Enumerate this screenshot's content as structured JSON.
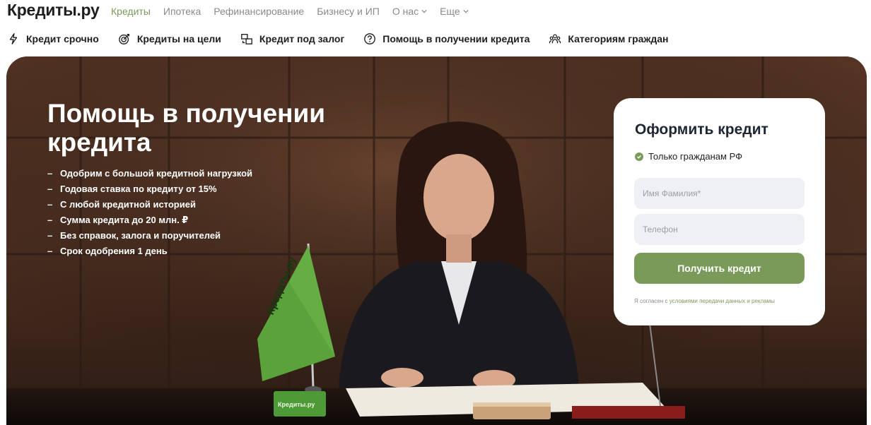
{
  "logo": "Кредиты.ру",
  "menu": [
    {
      "label": "Кредиты",
      "active": true
    },
    {
      "label": "Ипотека"
    },
    {
      "label": "Рефинансирование"
    },
    {
      "label": "Бизнесу и ИП"
    },
    {
      "label": "О нас",
      "dropdown": true
    },
    {
      "label": "Еще",
      "dropdown": true
    }
  ],
  "subnav": [
    {
      "label": "Кредит срочно",
      "icon": "lightning-icon"
    },
    {
      "label": "Кредиты на цели",
      "icon": "target-icon"
    },
    {
      "label": "Кредит под залог",
      "icon": "collateral-icon"
    },
    {
      "label": "Помощь в получении кредита",
      "icon": "question-icon"
    },
    {
      "label": "Категориям граждан",
      "icon": "people-icon"
    }
  ],
  "hero": {
    "title": "Помощь в получении кредита",
    "features": [
      "Одобрим с большой кредитной нагрузкой",
      "Годовая ставка по кредиту от 15%",
      "С любой кредитной историей",
      "Сумма кредита до 20 млн. ₽",
      "Без справок, залога и поручителей",
      "Срок одобрения 1 день"
    ],
    "dash": "–",
    "flag_text": "Кредиты.ру",
    "desk_sign": "Кредиты.ру"
  },
  "form": {
    "title": "Оформить кредит",
    "badge": "Только гражданам РФ",
    "name_placeholder": "Имя Фамилия*",
    "phone_placeholder": "Телефон",
    "submit": "Получить кредит",
    "consent_prefix": "Я согласен с",
    "consent_link": "условиями передачи данных и рекламы"
  },
  "colors": {
    "accent": "#7a9a5a",
    "field_bg": "#eef0f4",
    "title": "#1c2733"
  }
}
